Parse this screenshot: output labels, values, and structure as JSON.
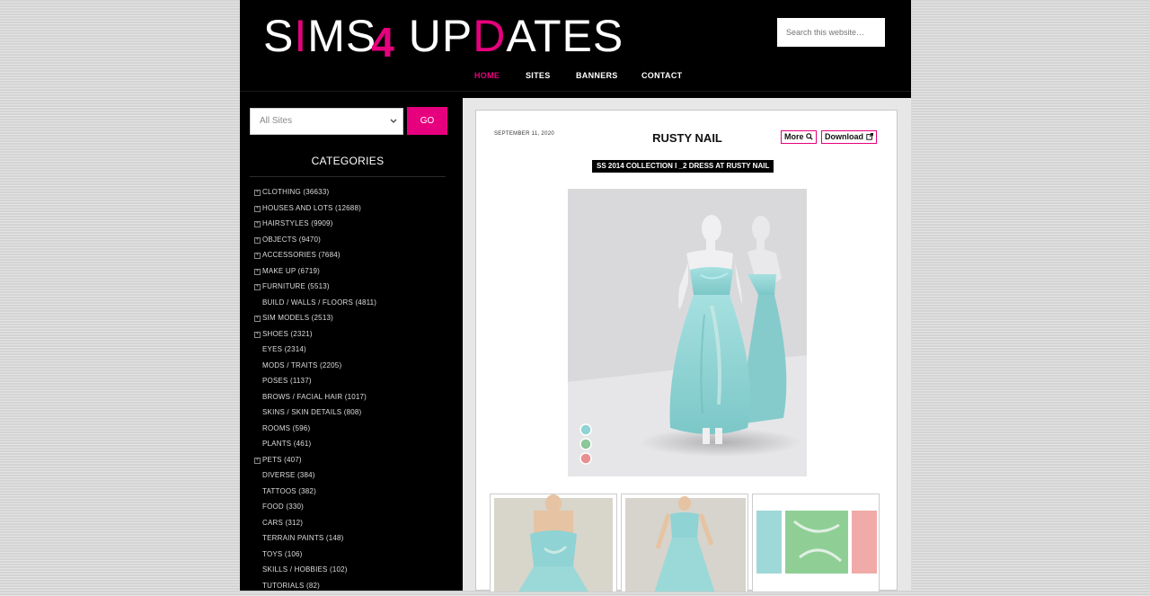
{
  "header": {
    "logo": {
      "part1": "S",
      "i": "I",
      "part2": "MS",
      "four": "4",
      "part3": " UP",
      "d": "D",
      "part4": "ATES"
    },
    "search_placeholder": "Search this website…",
    "nav": [
      {
        "label": "HOME",
        "active": true
      },
      {
        "label": "SITES",
        "active": false
      },
      {
        "label": "BANNERS",
        "active": false
      },
      {
        "label": "CONTACT",
        "active": false
      }
    ]
  },
  "sidebar": {
    "filter_value": "All Sites",
    "go_label": "GO",
    "categories_title": "CATEGORIES",
    "categories": [
      {
        "label": "CLOTHING (36633)",
        "expandable": true
      },
      {
        "label": "HOUSES AND LOTS (12688)",
        "expandable": true
      },
      {
        "label": "HAIRSTYLES (9909)",
        "expandable": true
      },
      {
        "label": "OBJECTS (9470)",
        "expandable": true
      },
      {
        "label": "ACCESSORIES (7684)",
        "expandable": true
      },
      {
        "label": "MAKE UP (6719)",
        "expandable": true
      },
      {
        "label": "FURNITURE (5513)",
        "expandable": true
      },
      {
        "label": "BUILD / WALLS / FLOORS (4811)",
        "expandable": false
      },
      {
        "label": "SIM MODELS (2513)",
        "expandable": true
      },
      {
        "label": "SHOES (2321)",
        "expandable": true
      },
      {
        "label": "EYES (2314)",
        "expandable": false
      },
      {
        "label": "MODS / TRAITS (2205)",
        "expandable": false
      },
      {
        "label": "POSES (1137)",
        "expandable": false
      },
      {
        "label": "BROWS / FACIAL HAIR (1017)",
        "expandable": false
      },
      {
        "label": "SKINS / SKIN DETAILS (808)",
        "expandable": false
      },
      {
        "label": "ROOMS (596)",
        "expandable": false
      },
      {
        "label": "PLANTS (461)",
        "expandable": false
      },
      {
        "label": "PETS (407)",
        "expandable": true
      },
      {
        "label": "DIVERSE (384)",
        "expandable": false
      },
      {
        "label": "TATTOOS (382)",
        "expandable": false
      },
      {
        "label": "FOOD (330)",
        "expandable": false
      },
      {
        "label": "CARS (312)",
        "expandable": false
      },
      {
        "label": "TERRAIN PAINTS (148)",
        "expandable": false
      },
      {
        "label": "TOYS (106)",
        "expandable": false
      },
      {
        "label": "SKILLS / HOBBIES (102)",
        "expandable": false
      },
      {
        "label": "TUTORIALS (82)",
        "expandable": false
      }
    ]
  },
  "post": {
    "date": "SEPTEMBER 11, 2020",
    "title": "RUSTY NAIL",
    "more_label": "More",
    "download_label": "Download",
    "subtitle": "SS 2014 COLLECTION I _2 DRESS AT RUSTY NAIL"
  },
  "colors": {
    "accent": "#e6007e",
    "dress": "#8fd3d4"
  }
}
